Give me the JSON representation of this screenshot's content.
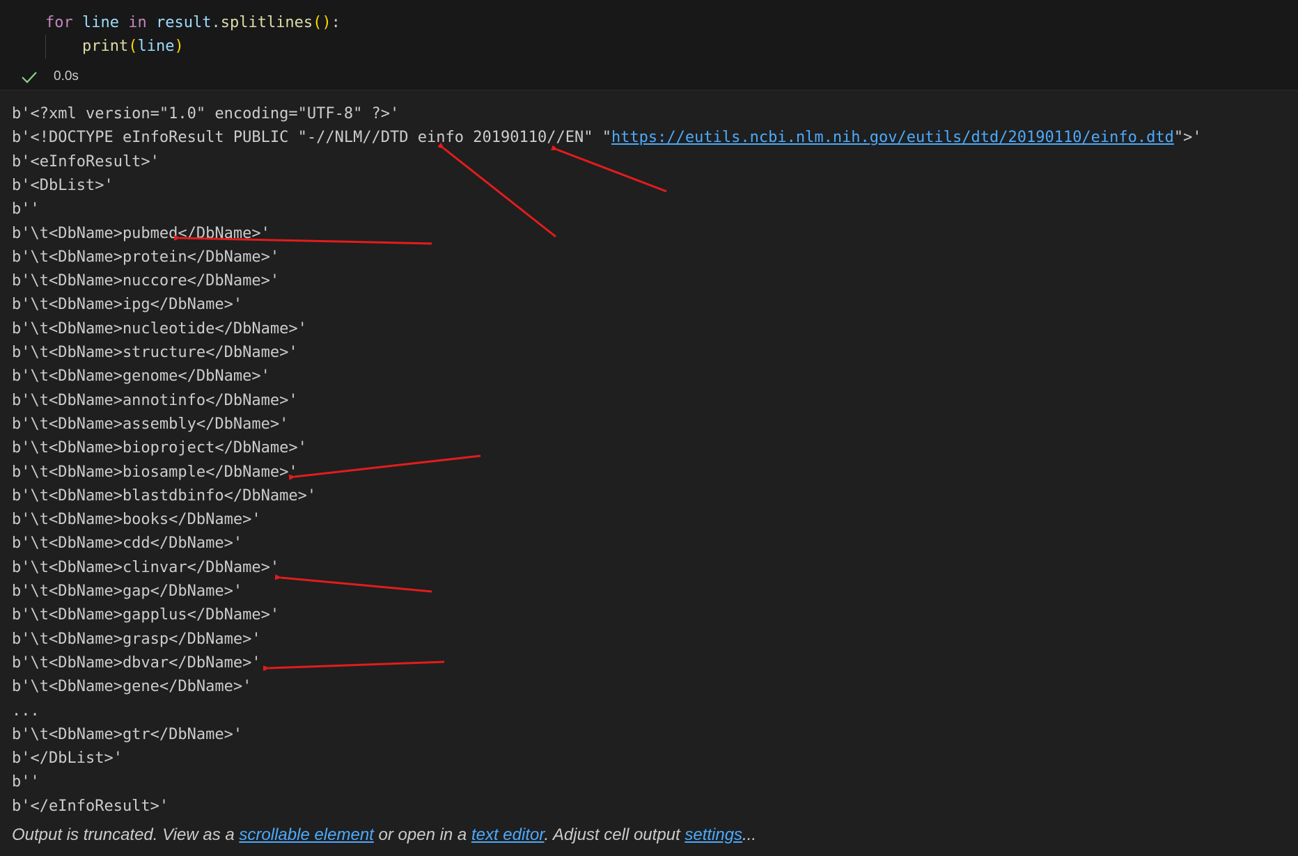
{
  "code_cell": {
    "lines": [
      {
        "tokens": [
          {
            "t": "for",
            "c": "kw"
          },
          {
            "t": " ",
            "c": "pl"
          },
          {
            "t": "line",
            "c": "var"
          },
          {
            "t": " ",
            "c": "pl"
          },
          {
            "t": "in",
            "c": "kw"
          },
          {
            "t": " ",
            "c": "pl"
          },
          {
            "t": "result",
            "c": "var"
          },
          {
            "t": ".",
            "c": "pl"
          },
          {
            "t": "splitlines",
            "c": "fn"
          },
          {
            "t": "()",
            "c": "br"
          },
          {
            "t": ":",
            "c": "pl"
          }
        ]
      },
      {
        "tokens": [
          {
            "t": "    ",
            "c": "pl"
          },
          {
            "t": "print",
            "c": "fn"
          },
          {
            "t": "(",
            "c": "br"
          },
          {
            "t": "line",
            "c": "var"
          },
          {
            "t": ")",
            "c": "br"
          }
        ]
      }
    ],
    "status_icon": "check-icon",
    "exec_time": "0.0s",
    "status_color": "#89d185"
  },
  "output": {
    "lines": [
      "b'<?xml version=\"1.0\" encoding=\"UTF-8\" ?>'",
      "__DOCTYPE__",
      "b'<eInfoResult>'",
      "b'<DbList>'",
      "b''",
      "b'\\t<DbName>pubmed</DbName>'",
      "b'\\t<DbName>protein</DbName>'",
      "b'\\t<DbName>nuccore</DbName>'",
      "b'\\t<DbName>ipg</DbName>'",
      "b'\\t<DbName>nucleotide</DbName>'",
      "b'\\t<DbName>structure</DbName>'",
      "b'\\t<DbName>genome</DbName>'",
      "b'\\t<DbName>annotinfo</DbName>'",
      "b'\\t<DbName>assembly</DbName>'",
      "b'\\t<DbName>bioproject</DbName>'",
      "b'\\t<DbName>biosample</DbName>'",
      "b'\\t<DbName>blastdbinfo</DbName>'",
      "b'\\t<DbName>books</DbName>'",
      "b'\\t<DbName>cdd</DbName>'",
      "b'\\t<DbName>clinvar</DbName>'",
      "b'\\t<DbName>gap</DbName>'",
      "b'\\t<DbName>gapplus</DbName>'",
      "b'\\t<DbName>grasp</DbName>'",
      "b'\\t<DbName>dbvar</DbName>'",
      "b'\\t<DbName>gene</DbName>'",
      "...",
      "b'\\t<DbName>gtr</DbName>'",
      "b'</DbList>'",
      "b''",
      "b'</eInfoResult>'"
    ],
    "doctype": {
      "prefix": "b'<!DOCTYPE eInfoResult PUBLIC \"-//NLM//DTD einfo 20190110//EN\" \"",
      "link": "https://eutils.ncbi.nlm.nih.gov/eutils/dtd/20190110/einfo.dtd",
      "suffix": "\">'"
    }
  },
  "truncation_note": {
    "text1": "Output is truncated. View as a ",
    "link1": "scrollable element",
    "text2": " or open in a ",
    "link2": "text editor",
    "text3": ". Adjust cell output ",
    "link3": "settings",
    "text4": "..."
  },
  "colors": {
    "background": "#1f1f1f",
    "code_background": "#181818",
    "text": "#cccccc",
    "link": "#4daafc",
    "annotation_arrow": "#e31c1c"
  }
}
